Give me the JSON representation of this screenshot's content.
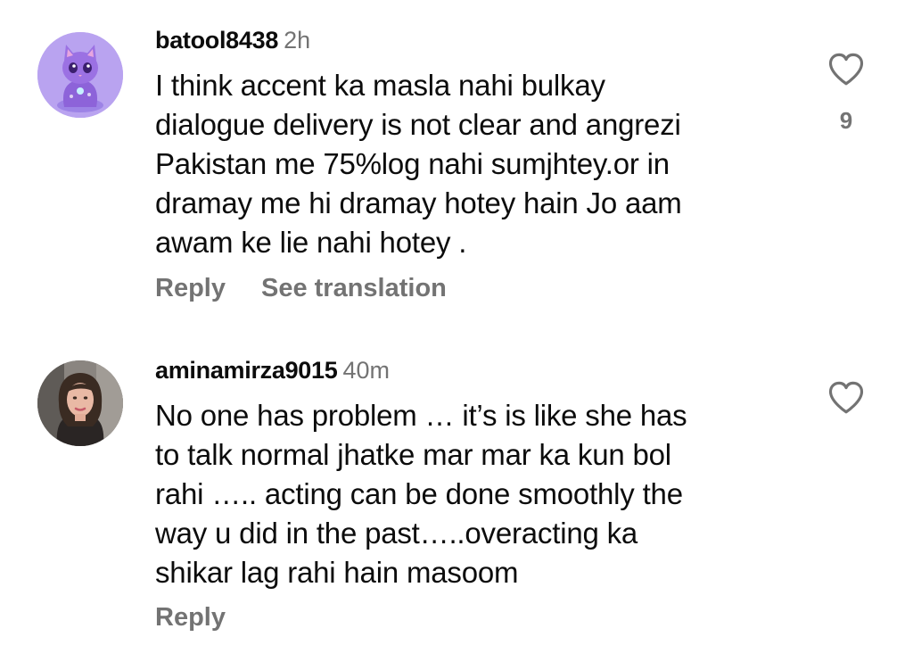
{
  "colors": {
    "text_primary": "#0c0c0c",
    "text_secondary": "#737373",
    "background": "#ffffff"
  },
  "comments": [
    {
      "username": "batool8438",
      "time": "2h",
      "avatar_icon": "purple-cat-avatar",
      "text": "I think accent ka masla nahi bulkay\ndialogue delivery is not clear and angrezi\nPakistan me 75%log nahi sumjhtey.or in\ndramay me hi dramay hotey hain Jo aam\nawam ke lie nahi hotey .",
      "reply_label": "Reply",
      "translation_label": "See translation",
      "like_icon": "heart-outline-icon",
      "like_count": "9"
    },
    {
      "username": "aminamirza9015",
      "time": "40m",
      "avatar_icon": "profile-photo-avatar",
      "text": "No one has problem … it’s is like she has\nto talk normal jhatke mar mar ka kun bol\nrahi ….. acting can be done smoothly the\nway u did in the past…..overacting ka\nshikar lag rahi hain masoom",
      "reply_label": "Reply",
      "like_icon": "heart-outline-icon"
    }
  ]
}
